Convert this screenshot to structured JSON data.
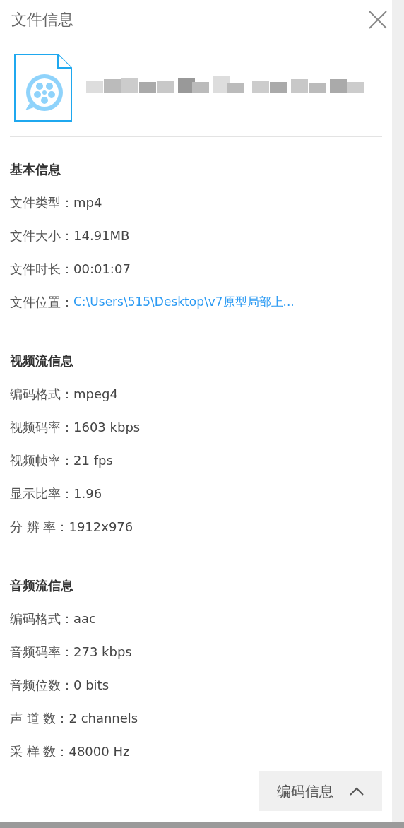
{
  "window": {
    "title": "文件信息"
  },
  "sections": [
    {
      "heading": "基本信息",
      "rows": [
        {
          "label": "文件类型：",
          "value": "mp4",
          "kind": "text"
        },
        {
          "label": "文件大小：",
          "value": "14.91MB",
          "kind": "text"
        },
        {
          "label": "文件时长：",
          "value": "00:01:07",
          "kind": "text"
        },
        {
          "label": "文件位置：",
          "value": "C:\\Users\\515\\Desktop\\v7原型局部上...",
          "kind": "link"
        }
      ]
    },
    {
      "heading": "视频流信息",
      "rows": [
        {
          "label": "编码格式：",
          "value": "mpeg4",
          "kind": "text"
        },
        {
          "label": "视频码率：",
          "value": "1603 kbps",
          "kind": "text"
        },
        {
          "label": "视频帧率：",
          "value": "21 fps",
          "kind": "text"
        },
        {
          "label": "显示比率：",
          "value": "1.96",
          "kind": "text"
        },
        {
          "label": "分 辨 率：",
          "value": "1912x976",
          "kind": "text"
        }
      ]
    },
    {
      "heading": "音频流信息",
      "rows": [
        {
          "label": "编码格式：",
          "value": "aac",
          "kind": "text"
        },
        {
          "label": "音频码率：",
          "value": "273 kbps",
          "kind": "text"
        },
        {
          "label": "音频位数：",
          "value": "0 bits",
          "kind": "text"
        },
        {
          "label": "声 道 数：",
          "value": "2 channels",
          "kind": "text"
        },
        {
          "label": "采 样 数：",
          "value": "48000 Hz",
          "kind": "text"
        }
      ]
    }
  ],
  "footer": {
    "button": "编码信息"
  }
}
